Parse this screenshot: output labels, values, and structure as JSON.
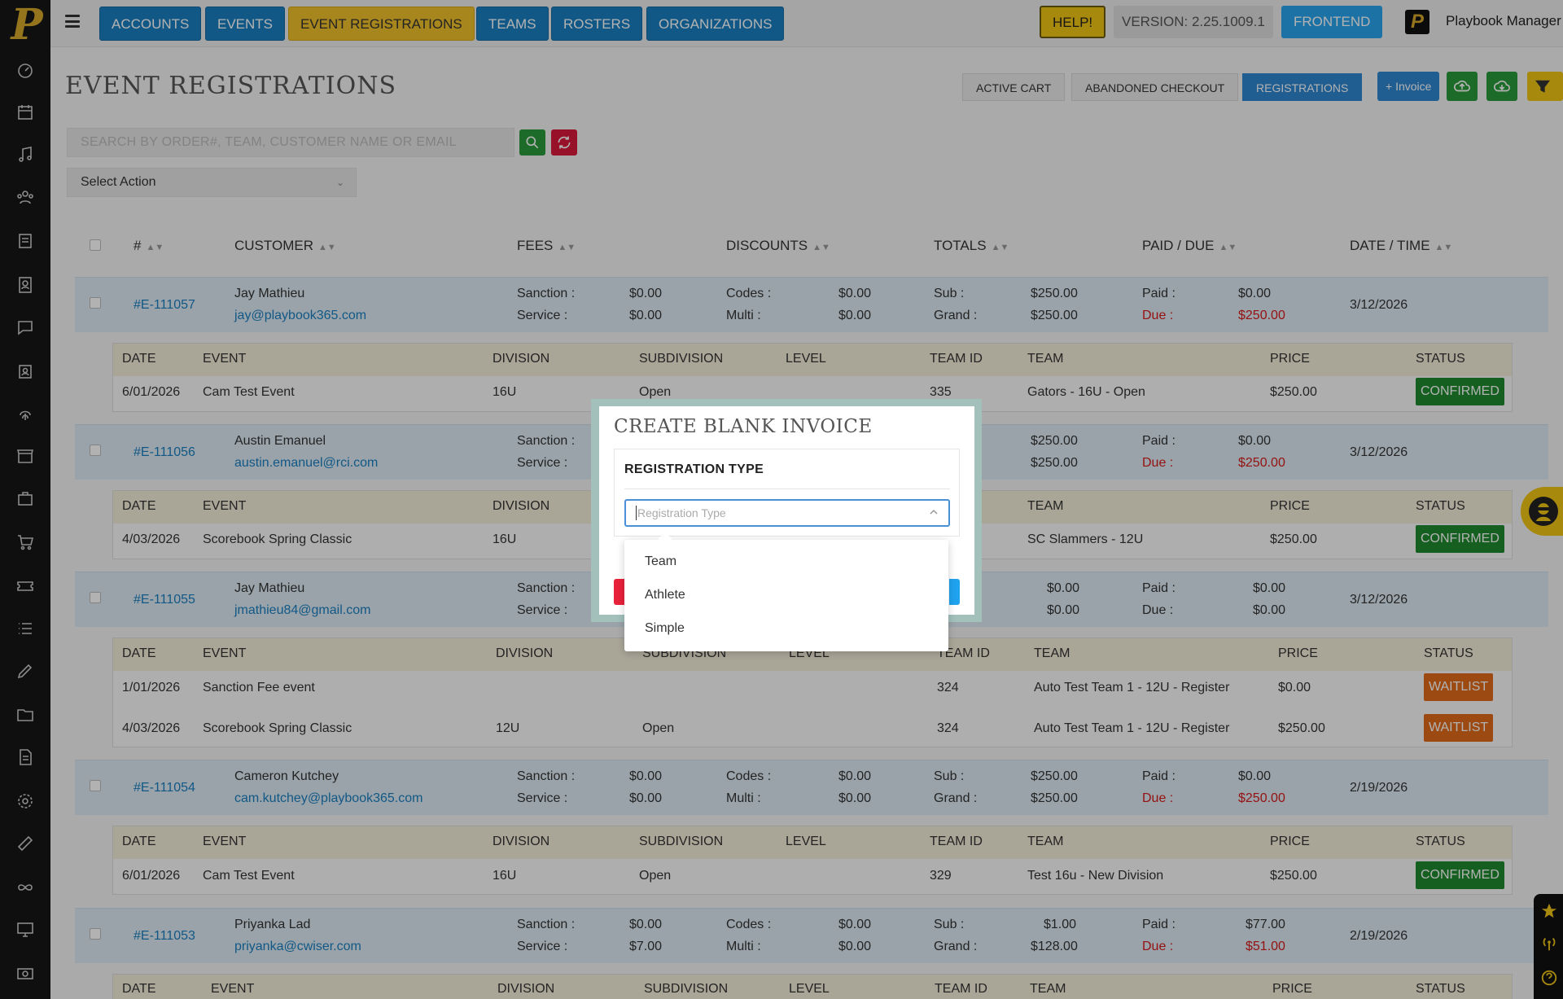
{
  "nav": {
    "items": [
      "ACCOUNTS",
      "EVENTS",
      "EVENT REGISTRATIONS",
      "TEAMS",
      "ROSTERS",
      "ORGANIZATIONS"
    ],
    "help": "HELP!",
    "version": "VERSION: 2.25.1009.1",
    "frontend": "FRONTEND",
    "user": "Playbook Manager"
  },
  "page": {
    "title": "EVENT REGISTRATIONS",
    "segments": [
      "ACTIVE CART",
      "ABANDONED CHECKOUT",
      "REGISTRATIONS"
    ],
    "invoice_btn": "+ Invoice",
    "search_placeholder": "SEARCH BY ORDER#, TEAM, CUSTOMER NAME OR EMAIL",
    "select_action": "Select Action"
  },
  "table": {
    "headers": [
      "#",
      "CUSTOMER",
      "FEES",
      "DISCOUNTS",
      "TOTALS",
      "PAID / DUE",
      "DATE / TIME"
    ],
    "sub_headers": [
      "DATE",
      "EVENT",
      "DIVISION",
      "SUBDIVISION",
      "LEVEL",
      "TEAM ID",
      "TEAM",
      "PRICE",
      "STATUS"
    ],
    "labels": {
      "sanction": "Sanction :",
      "service": "Service :",
      "codes": "Codes :",
      "multi": "Multi :",
      "sub": "Sub :",
      "grand": "Grand :",
      "paid": "Paid :",
      "due": "Due :"
    },
    "orders": [
      {
        "id": "#E-111057",
        "name": "Jay Mathieu",
        "email": "jay@playbook365.com",
        "sanction": "$0.00",
        "service": "$0.00",
        "codes": "$0.00",
        "multi": "$0.00",
        "sub": "$250.00",
        "grand": "$250.00",
        "paid": "$0.00",
        "due": "$250.00",
        "date": "3/12/2026",
        "items": [
          {
            "date": "6/01/2026",
            "event": "Cam Test Event",
            "division": "16U",
            "subdivision": "Open",
            "level": "",
            "team_id": "335",
            "team": "Gators - 16U - Open",
            "price": "$250.00",
            "status": "CONFIRMED"
          }
        ]
      },
      {
        "id": "#E-111056",
        "name": "Austin Emanuel",
        "email": "austin.emanuel@rci.com",
        "sanction": "",
        "service": "",
        "codes": "",
        "multi": "",
        "sub": "$250.00",
        "grand": "$250.00",
        "paid": "$0.00",
        "due": "$250.00",
        "date": "3/12/2026",
        "items": [
          {
            "date": "4/03/2026",
            "event": "Scorebook Spring Classic",
            "division": "16U",
            "subdivision": "",
            "level": "",
            "team_id": "",
            "team": "SC Slammers - 12U",
            "price": "$250.00",
            "status": "CONFIRMED"
          }
        ]
      },
      {
        "id": "#E-111055",
        "name": "Jay Mathieu",
        "email": "jmathieu84@gmail.com",
        "sanction": "",
        "service": "",
        "codes": "",
        "multi": "",
        "sub": "$0.00",
        "grand": "$0.00",
        "paid": "$0.00",
        "due": "$0.00",
        "date": "3/12/2026",
        "items": [
          {
            "date": "1/01/2026",
            "event": "Sanction Fee event",
            "division": "",
            "subdivision": "",
            "level": "",
            "team_id": "324",
            "team": "Auto Test Team 1 - 12U - Register",
            "price": "$0.00",
            "status": "WAITLIST"
          },
          {
            "date": "4/03/2026",
            "event": "Scorebook Spring Classic",
            "division": "12U",
            "subdivision": "Open",
            "level": "",
            "team_id": "324",
            "team": "Auto Test Team 1 - 12U - Register",
            "price": "$250.00",
            "status": "WAITLIST"
          }
        ]
      },
      {
        "id": "#E-111054",
        "name": "Cameron Kutchey",
        "email": "cam.kutchey@playbook365.com",
        "sanction": "$0.00",
        "service": "$0.00",
        "codes": "$0.00",
        "multi": "$0.00",
        "sub": "$250.00",
        "grand": "$250.00",
        "paid": "$0.00",
        "due": "$250.00",
        "date": "2/19/2026",
        "items": [
          {
            "date": "6/01/2026",
            "event": "Cam Test Event",
            "division": "16U",
            "subdivision": "Open",
            "level": "",
            "team_id": "329",
            "team": "Test 16u - New Division",
            "price": "$250.00",
            "status": "CONFIRMED"
          }
        ]
      },
      {
        "id": "#E-111053",
        "name": "Priyanka Lad",
        "email": "priyanka@cwiser.com",
        "sanction": "$0.00",
        "service": "$7.00",
        "codes": "$0.00",
        "multi": "$0.00",
        "sub": "$1.00",
        "grand": "$128.00",
        "paid": "$77.00",
        "due": "$51.00",
        "date": "2/19/2026",
        "items": []
      }
    ]
  },
  "modal": {
    "title": "CREATE BLANK INVOICE",
    "section": "REGISTRATION TYPE",
    "placeholder": "Registration Type",
    "options": [
      "Team",
      "Athlete",
      "Simple"
    ]
  },
  "colors": {
    "primary": "#1b7fc0",
    "accent": "#f0c02a",
    "confirmed": "#1f8a2e",
    "waitlist": "#e06a1a",
    "due": "#d61a1a"
  }
}
